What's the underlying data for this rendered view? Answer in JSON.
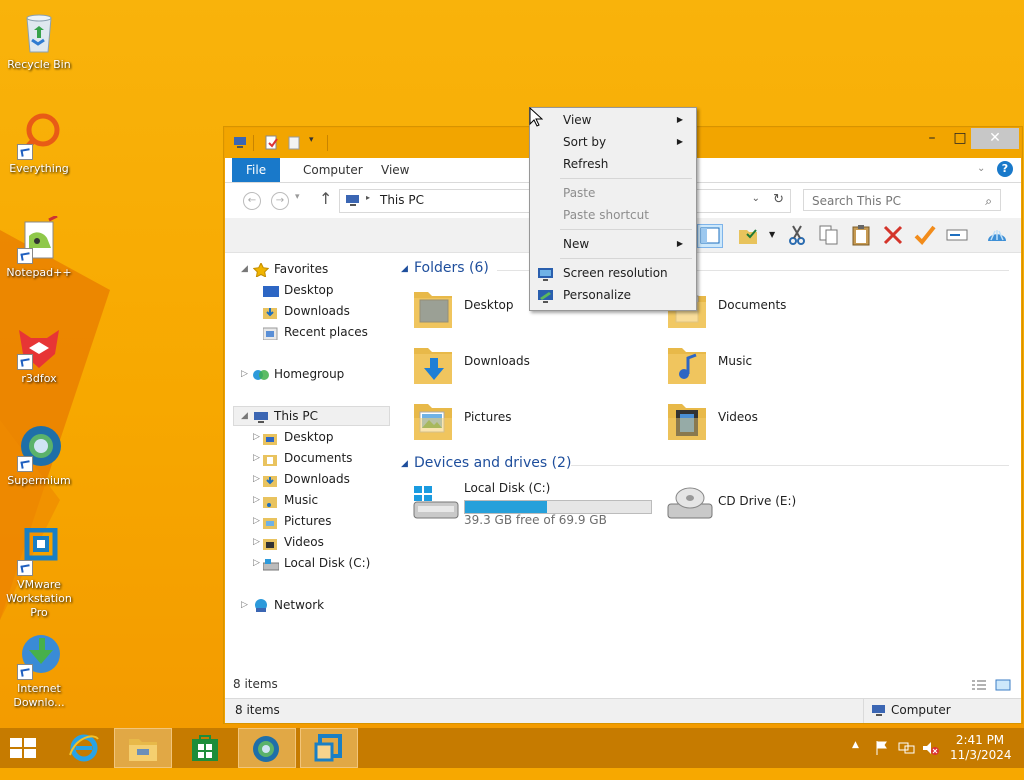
{
  "desktop": {
    "icons": [
      {
        "label": "Recycle Bin"
      },
      {
        "label": "Everything"
      },
      {
        "label": "Notepad++"
      },
      {
        "label": "r3dfox"
      },
      {
        "label": "Supermium"
      },
      {
        "label": "VMware Workstation Pro"
      },
      {
        "label": "Internet Downlo..."
      }
    ]
  },
  "explorer": {
    "tabs": [
      "File",
      "Computer",
      "View"
    ],
    "address": "This PC",
    "search_placeholder": "Search This PC",
    "nav": {
      "favorites": "Favorites",
      "favorites_items": [
        "Desktop",
        "Downloads",
        "Recent places"
      ],
      "homegroup": "Homegroup",
      "thispc": "This PC",
      "thispc_items": [
        "Desktop",
        "Documents",
        "Downloads",
        "Music",
        "Pictures",
        "Videos",
        "Local Disk (C:)"
      ],
      "network": "Network"
    },
    "folders_header": "Folders (6)",
    "folders": [
      "Desktop",
      "Documents",
      "Downloads",
      "Music",
      "Pictures",
      "Videos"
    ],
    "drives_header": "Devices and drives (2)",
    "drives": [
      {
        "name": "Local Disk (C:)",
        "free": "39.3 GB free of 69.9 GB",
        "used_fraction": 0.44
      },
      {
        "name": "CD Drive (E:)"
      }
    ],
    "status_items": "8 items",
    "bottom_items": "8 items",
    "bottom_location": "Computer"
  },
  "context_menu": {
    "items": [
      {
        "label": "View",
        "submenu": true,
        "disabled": false
      },
      {
        "label": "Sort by",
        "submenu": true,
        "disabled": false
      },
      {
        "label": "Refresh",
        "submenu": false,
        "disabled": false
      },
      {
        "label": "Paste",
        "submenu": false,
        "disabled": true
      },
      {
        "label": "Paste shortcut",
        "submenu": false,
        "disabled": true
      },
      {
        "label": "New",
        "submenu": true,
        "disabled": false
      },
      {
        "label": "Screen resolution",
        "submenu": false,
        "disabled": false
      },
      {
        "label": "Personalize",
        "submenu": false,
        "disabled": false
      }
    ]
  },
  "taskbar": {
    "time": "2:41 PM",
    "date": "11/3/2024"
  },
  "colors": {
    "desktop": "#f7a800",
    "taskbar": "#c67b00",
    "accent_blue": "#1979ca",
    "drive_fill": "#26a0da"
  }
}
